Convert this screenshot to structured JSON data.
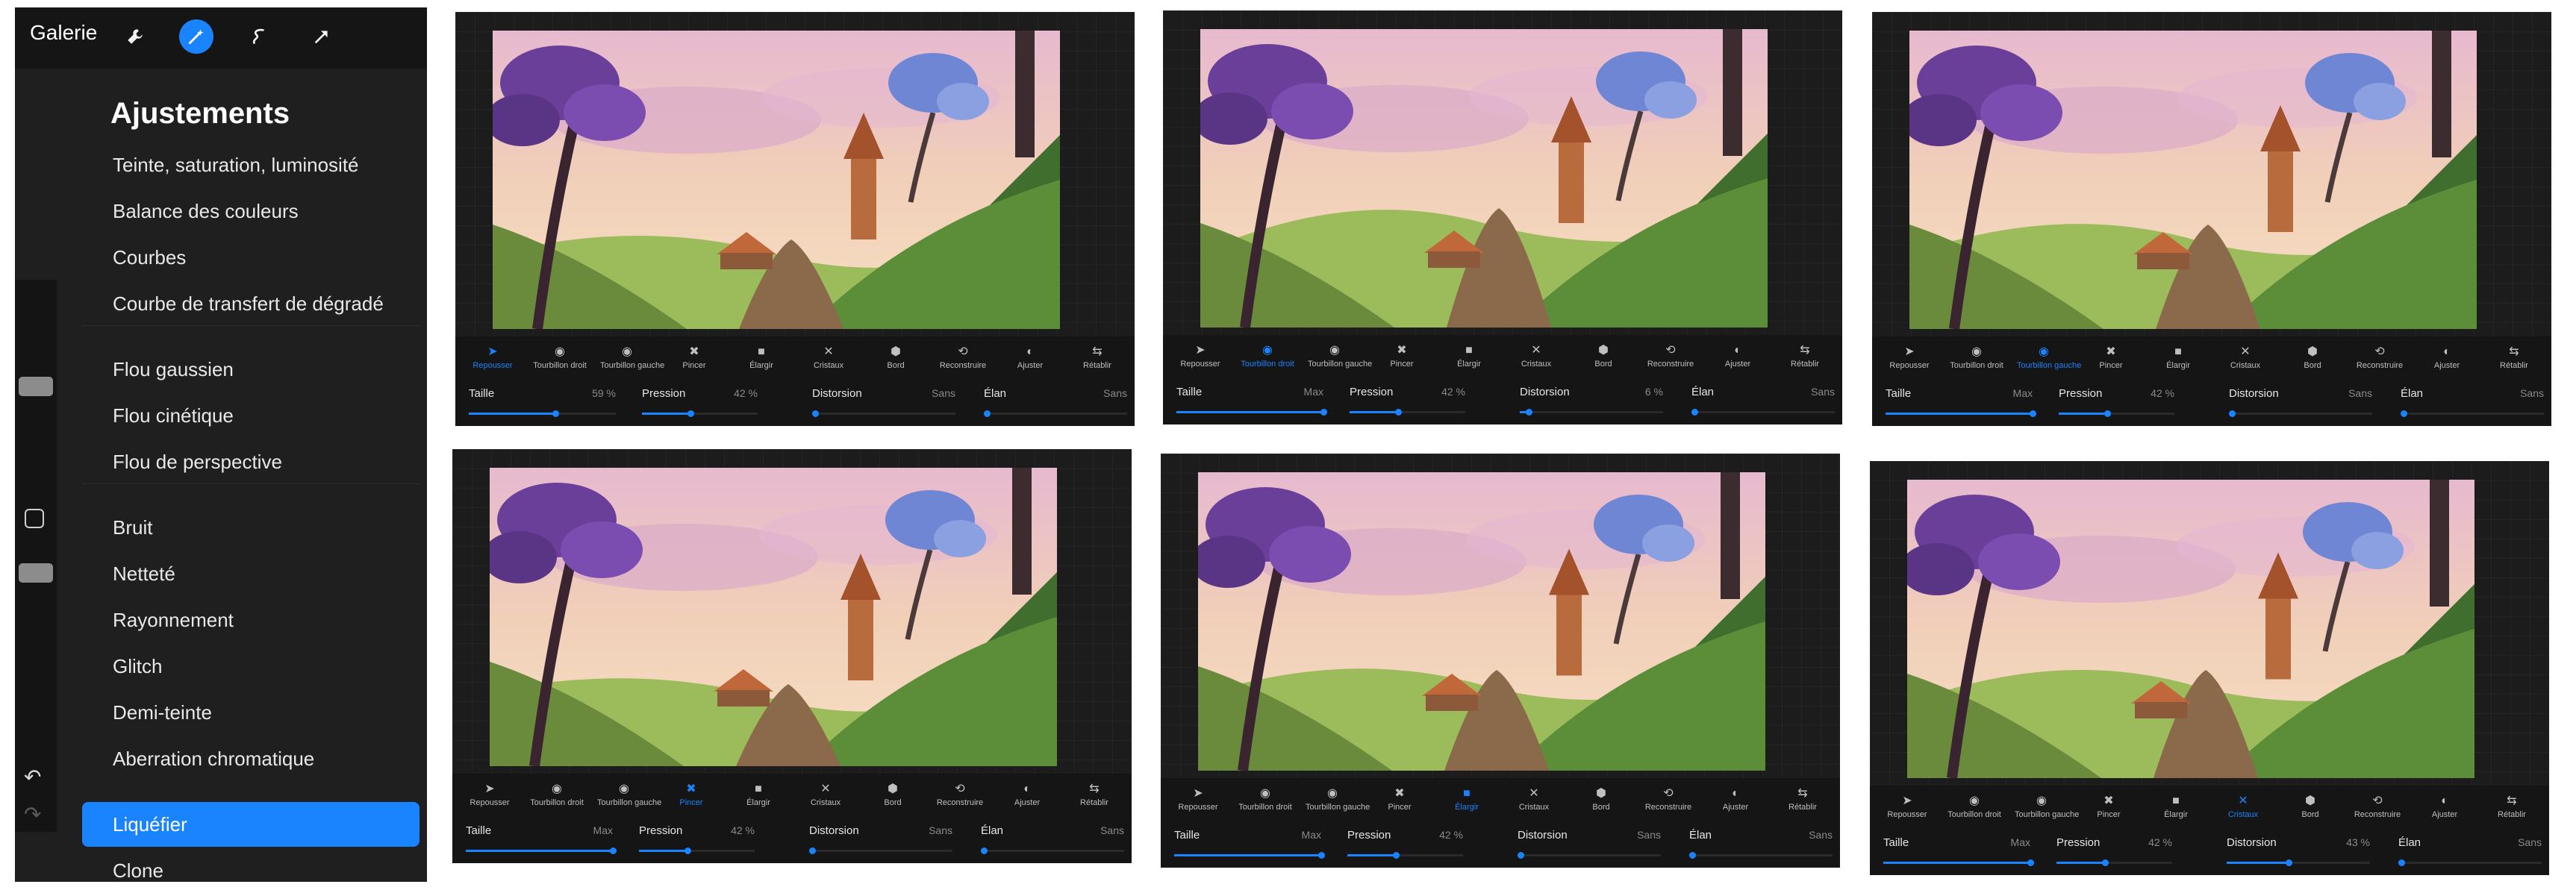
{
  "topbar": {
    "gallery": "Galerie",
    "tools": [
      {
        "icon": "wrench-icon",
        "active": false
      },
      {
        "icon": "magic-wand-icon",
        "active": true
      },
      {
        "icon": "selection-icon",
        "active": false
      },
      {
        "icon": "transform-arrow-icon",
        "active": false
      }
    ]
  },
  "menu": {
    "title": "Ajustements",
    "items": [
      "Teinte, saturation, luminosité",
      "Balance des couleurs",
      "Courbes",
      "Courbe de transfert de dégradé",
      "Flou gaussien",
      "Flou cinétique",
      "Flou de perspective",
      "Bruit",
      "Netteté",
      "Rayonnement",
      "Glitch",
      "Demi-teinte",
      "Aberration chromatique",
      "Liquéfier",
      "Clone"
    ],
    "active_item": "Liquéfier"
  },
  "colors": {
    "accent": "#1a84ff",
    "panel": "#1f1f1f",
    "toolbar": "#151515"
  },
  "liquify_tools": [
    "Repousser",
    "Tourbillon droit",
    "Tourbillon gauche",
    "Pincer",
    "Élargir",
    "Cristaux",
    "Bord",
    "Reconstruire",
    "Ajuster",
    "Rétablir"
  ],
  "param_labels": [
    "Taille",
    "Pression",
    "Distorsion",
    "Élan"
  ],
  "thumbnails": [
    {
      "active_tool": "Repousser",
      "values": [
        "59 %",
        "42 %",
        "Sans",
        "Sans"
      ],
      "levels": [
        0.59,
        0.42,
        0.0,
        0.0
      ]
    },
    {
      "active_tool": "Tourbillon droit",
      "values": [
        "Max",
        "42 %",
        "6 %",
        "Sans"
      ],
      "levels": [
        1.0,
        0.42,
        0.06,
        0.0
      ]
    },
    {
      "active_tool": "Tourbillon gauche",
      "values": [
        "Max",
        "42 %",
        "Sans",
        "Sans"
      ],
      "levels": [
        1.0,
        0.42,
        0.0,
        0.0
      ]
    },
    {
      "active_tool": "Pincer",
      "values": [
        "Max",
        "42 %",
        "Sans",
        "Sans"
      ],
      "levels": [
        1.0,
        0.42,
        0.0,
        0.0
      ]
    },
    {
      "active_tool": "Élargir",
      "values": [
        "Max",
        "42 %",
        "Sans",
        "Sans"
      ],
      "levels": [
        1.0,
        0.42,
        0.0,
        0.0
      ]
    },
    {
      "active_tool": "Cristaux",
      "values": [
        "Max",
        "42 %",
        "43 %",
        "Sans"
      ],
      "levels": [
        1.0,
        0.42,
        0.43,
        0.0
      ]
    }
  ]
}
